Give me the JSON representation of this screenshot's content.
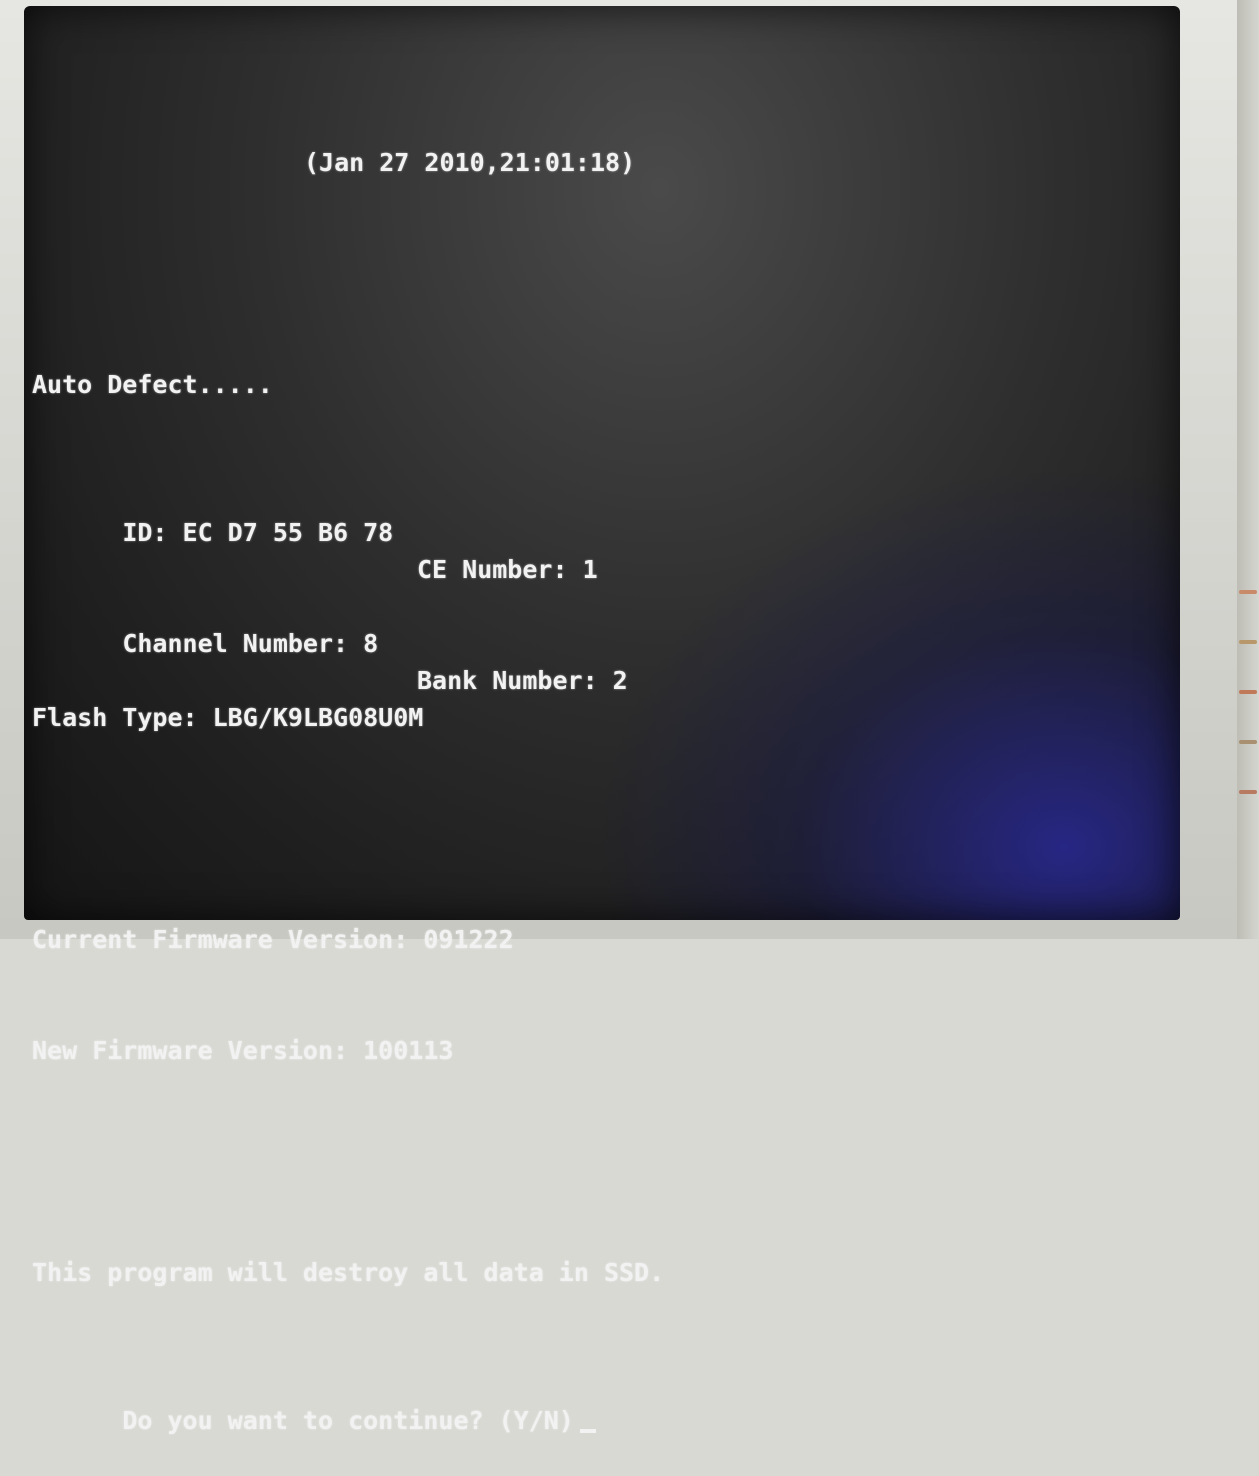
{
  "console": {
    "timestamp": "(Jan 27 2010,21:01:18)",
    "auto_defect": "Auto Defect.....",
    "id_line": "ID: EC D7 55 B6 78",
    "ce_number": "CE Number: 1",
    "channel_number": "Channel Number: 8",
    "bank_number": "Bank Number: 2",
    "flash_type": "Flash Type: LBG/K9LBG08U0M",
    "current_firmware": "Current Firmware Version: 091222",
    "new_firmware": "New Firmware Version: 100113",
    "warning": "This program will destroy all data in SSD.",
    "prompt": "Do you want to continue? (Y/N)"
  },
  "colors": {
    "text": "#f2f2f2",
    "screen_background": "#2e2e2e",
    "bezel": "#d9d9d4"
  }
}
